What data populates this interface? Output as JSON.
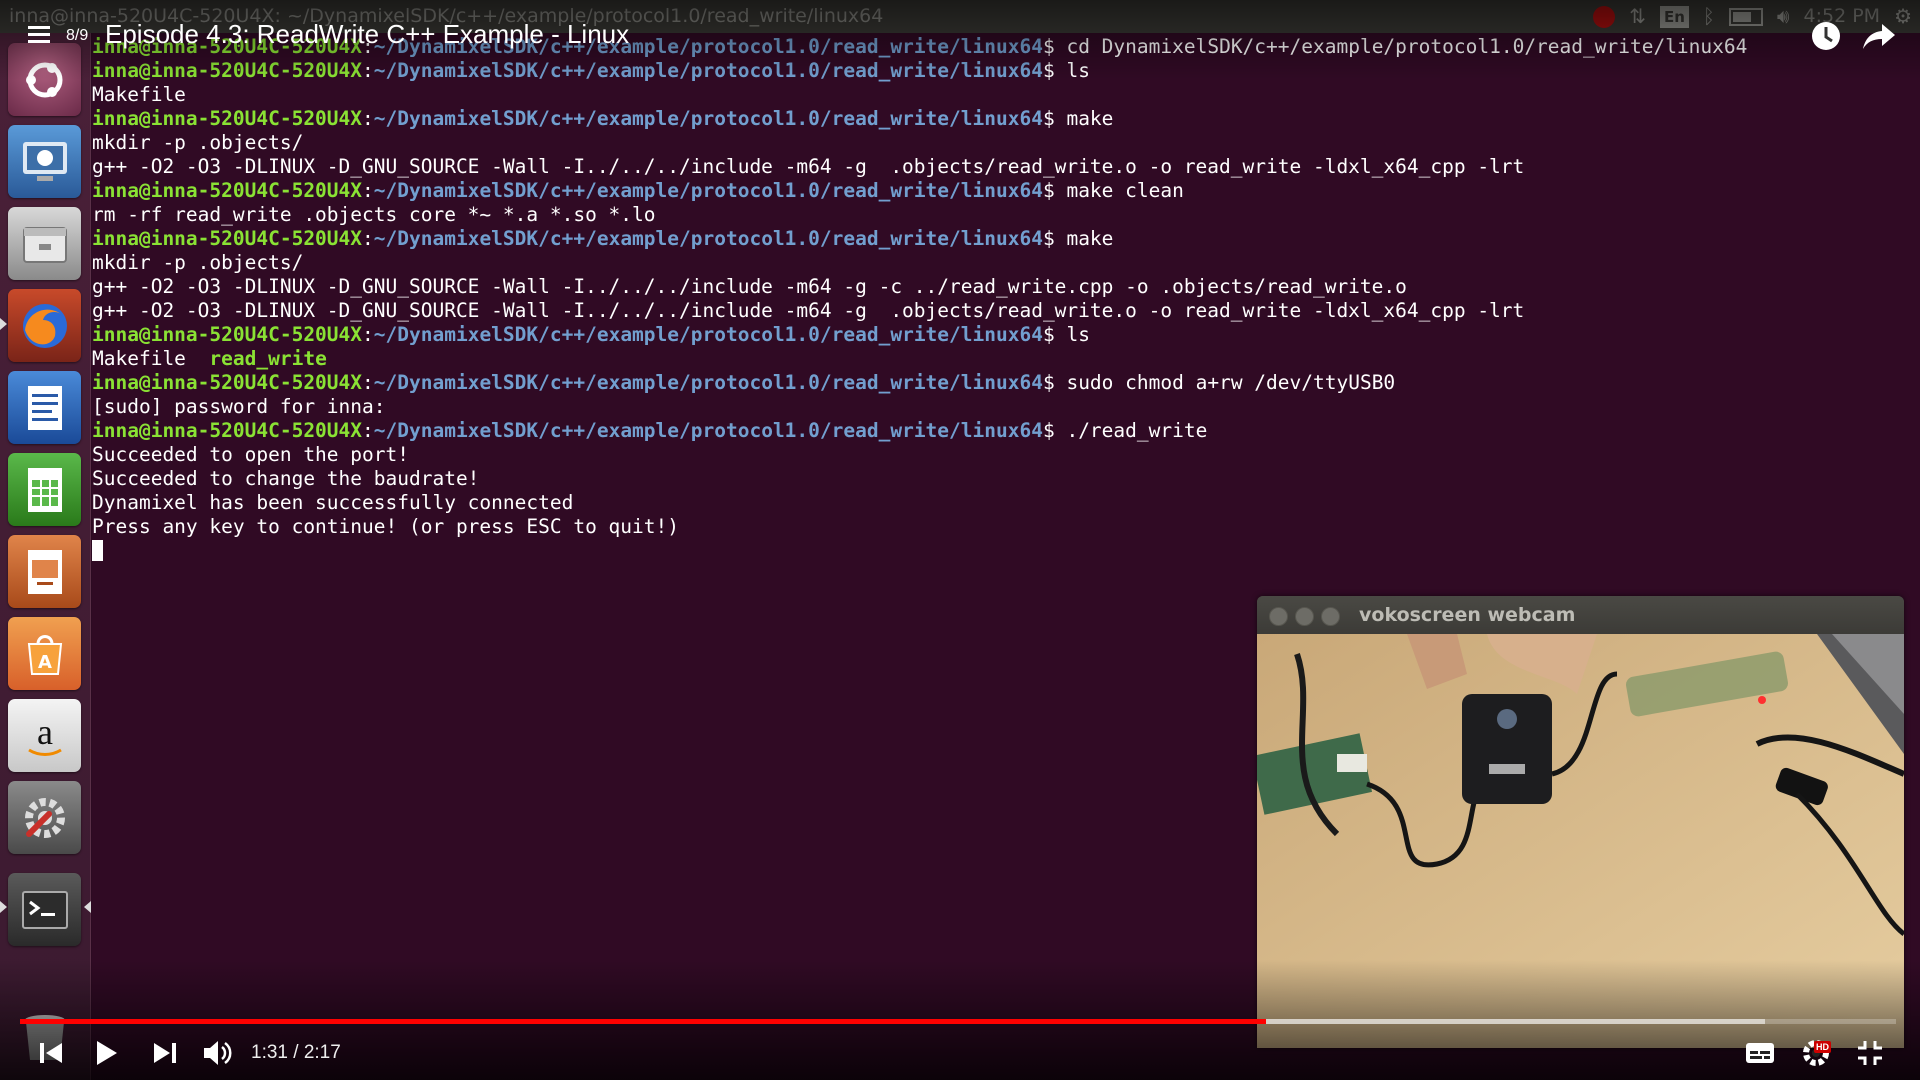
{
  "top_panel": {
    "window_title": "inna@inna-520U4C-520U4X: ~/DynamixelSDK/c++/example/protocol1.0/read_write/linux64",
    "keyboard_layout": "En",
    "clock": "4:52 PM"
  },
  "launcher": {
    "items": [
      {
        "icon": "ubuntu-dash-icon"
      },
      {
        "icon": "system-monitor-icon"
      },
      {
        "icon": "files-icon"
      },
      {
        "icon": "firefox-icon"
      },
      {
        "icon": "writer-icon"
      },
      {
        "icon": "calc-icon"
      },
      {
        "icon": "impress-icon"
      },
      {
        "icon": "software-center-icon"
      },
      {
        "icon": "amazon-icon"
      },
      {
        "icon": "system-settings-icon"
      },
      {
        "icon": "terminal-icon"
      },
      {
        "icon": "trash-icon"
      }
    ]
  },
  "terminal": {
    "user_host": "inna@inna-520U4C-520U4X",
    "path": "~/DynamixelSDK/c++/example/protocol1.0/read_write/linux64",
    "lines": [
      {
        "kind": "prompt",
        "cmd": "cd DynamixelSDK/c++/example/protocol1.0/read_write/linux64"
      },
      {
        "kind": "prompt",
        "cmd": "ls"
      },
      {
        "kind": "output",
        "text": "Makefile"
      },
      {
        "kind": "prompt",
        "cmd": "make"
      },
      {
        "kind": "output",
        "text": "mkdir -p .objects/"
      },
      {
        "kind": "output",
        "text": "g++ -O2 -O3 -DLINUX -D_GNU_SOURCE -Wall -I../../../include -m64 -g  .objects/read_write.o -o read_write -ldxl_x64_cpp -lrt"
      },
      {
        "kind": "prompt",
        "cmd": "make clean"
      },
      {
        "kind": "output",
        "text": "rm -rf read_write .objects core *~ *.a *.so *.lo"
      },
      {
        "kind": "prompt",
        "cmd": "make"
      },
      {
        "kind": "output",
        "text": "mkdir -p .objects/"
      },
      {
        "kind": "output",
        "text": "g++ -O2 -O3 -DLINUX -D_GNU_SOURCE -Wall -I../../../include -m64 -g -c ../read_write.cpp -o .objects/read_write.o"
      },
      {
        "kind": "output",
        "text": "g++ -O2 -O3 -DLINUX -D_GNU_SOURCE -Wall -I../../../include -m64 -g  .objects/read_write.o -o read_write -ldxl_x64_cpp -lrt"
      },
      {
        "kind": "prompt",
        "cmd": "ls"
      },
      {
        "kind": "ls",
        "file": "Makefile  ",
        "exe": "read_write"
      },
      {
        "kind": "prompt",
        "cmd": "sudo chmod a+rw /dev/ttyUSB0"
      },
      {
        "kind": "output",
        "text": "[sudo] password for inna:"
      },
      {
        "kind": "prompt",
        "cmd": "./read_write"
      },
      {
        "kind": "output",
        "text": "Succeeded to open the port!"
      },
      {
        "kind": "output",
        "text": "Succeeded to change the baudrate!"
      },
      {
        "kind": "output",
        "text": "Dynamixel has been successfully connected"
      },
      {
        "kind": "output",
        "text": "Press any key to continue! (or press ESC to quit!)"
      },
      {
        "kind": "cursor"
      }
    ]
  },
  "youtube": {
    "playlist_position": "8/9",
    "title": "Episode 4.3: ReadWrite C++ Example - Linux",
    "current_time": "1:31",
    "duration": "2:17",
    "time_display": "1:31 / 2:17",
    "played_fraction": 0.664,
    "buffered_fraction": 0.93,
    "hd_badge": "HD",
    "accent_color": "#ff0000"
  },
  "webcam_window": {
    "title": "vokoscreen webcam"
  }
}
